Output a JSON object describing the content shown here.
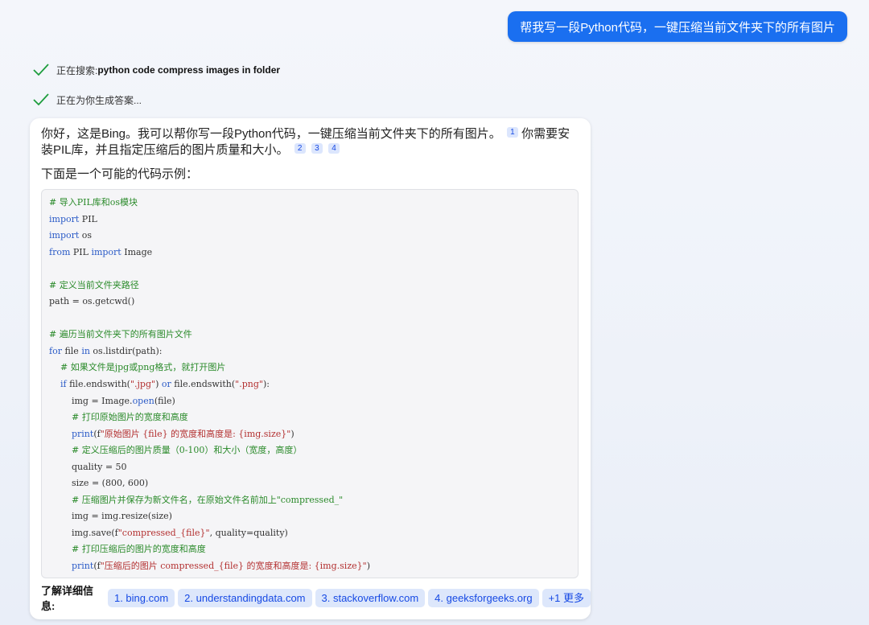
{
  "user_message": "帮我写一段Python代码，一键压缩当前文件夹下的所有图片",
  "status": {
    "searching_prefix": "正在搜索: ",
    "searching_query": "python code compress images in folder",
    "generating": "正在为你生成答案..."
  },
  "answer": {
    "p1a": "你好，这是Bing。我可以帮你写一段Python代码，一键压缩当前文件夹下的所有图片。",
    "cite1": "1",
    "p1b": "你需要安装PIL库，并且指定压缩后的图片质量和大小。",
    "cite2": "2",
    "cite3": "3",
    "cite4": "4",
    "intro": "下面是一个可能的代码示例："
  },
  "code_lines": [
    [
      {
        "t": "# 导入PIL库和os模块",
        "c": "c"
      }
    ],
    [
      {
        "t": "import",
        "c": "k"
      },
      {
        "t": " PIL",
        "c": ""
      }
    ],
    [
      {
        "t": "import",
        "c": "k"
      },
      {
        "t": " os",
        "c": ""
      }
    ],
    [
      {
        "t": "from",
        "c": "k"
      },
      {
        "t": " PIL ",
        "c": ""
      },
      {
        "t": "import",
        "c": "k"
      },
      {
        "t": " Image",
        "c": ""
      }
    ],
    [],
    [
      {
        "t": "# 定义当前文件夹路径",
        "c": "c"
      }
    ],
    [
      {
        "t": "path = os.getcwd()",
        "c": ""
      }
    ],
    [],
    [
      {
        "t": "# 遍历当前文件夹下的所有图片文件",
        "c": "c"
      }
    ],
    [
      {
        "t": "for",
        "c": "k"
      },
      {
        "t": " file ",
        "c": ""
      },
      {
        "t": "in",
        "c": "k"
      },
      {
        "t": " os.listdir(path):",
        "c": ""
      }
    ],
    [
      {
        "t": "    ",
        "c": ""
      },
      {
        "t": "# 如果文件是jpg或png格式，就打开图片",
        "c": "c"
      }
    ],
    [
      {
        "t": "    ",
        "c": ""
      },
      {
        "t": "if",
        "c": "k"
      },
      {
        "t": " file.endswith(",
        "c": ""
      },
      {
        "t": "\".jpg\"",
        "c": "s"
      },
      {
        "t": ") ",
        "c": ""
      },
      {
        "t": "or",
        "c": "k"
      },
      {
        "t": " file.endswith(",
        "c": ""
      },
      {
        "t": "\".png\"",
        "c": "s"
      },
      {
        "t": "):",
        "c": ""
      }
    ],
    [
      {
        "t": "        img = Image.",
        "c": ""
      },
      {
        "t": "open",
        "c": "f"
      },
      {
        "t": "(file)",
        "c": ""
      }
    ],
    [
      {
        "t": "        ",
        "c": ""
      },
      {
        "t": "# 打印原始图片的宽度和高度",
        "c": "c"
      }
    ],
    [
      {
        "t": "        ",
        "c": ""
      },
      {
        "t": "print",
        "c": "f"
      },
      {
        "t": "(f",
        "c": ""
      },
      {
        "t": "\"原始图片 {file} 的宽度和高度是: {img.size}\"",
        "c": "s"
      },
      {
        "t": ")",
        "c": ""
      }
    ],
    [
      {
        "t": "        ",
        "c": ""
      },
      {
        "t": "# 定义压缩后的图片质量（0-100）和大小（宽度，高度）",
        "c": "c"
      }
    ],
    [
      {
        "t": "        quality = 50",
        "c": ""
      }
    ],
    [
      {
        "t": "        size = (800, 600)",
        "c": ""
      }
    ],
    [
      {
        "t": "        ",
        "c": ""
      },
      {
        "t": "# 压缩图片并保存为新文件名，在原始文件名前加上\"compressed_\"",
        "c": "c"
      }
    ],
    [
      {
        "t": "        img = img.resize(size)",
        "c": ""
      }
    ],
    [
      {
        "t": "        img.save(f",
        "c": ""
      },
      {
        "t": "\"compressed_{file}\"",
        "c": "s"
      },
      {
        "t": ", quality=quality)",
        "c": ""
      }
    ],
    [
      {
        "t": "        ",
        "c": ""
      },
      {
        "t": "# 打印压缩后的图片的宽度和高度",
        "c": "c"
      }
    ],
    [
      {
        "t": "        ",
        "c": ""
      },
      {
        "t": "print",
        "c": "f"
      },
      {
        "t": "(f",
        "c": ""
      },
      {
        "t": "\"压缩后的图片 compressed_{file} 的宽度和高度是: {img.size}\"",
        "c": "s"
      },
      {
        "t": ")",
        "c": ""
      }
    ]
  ],
  "learn_more": {
    "label": "了解详细信息:",
    "sources": [
      "1. bing.com",
      "2. understandingdata.com",
      "3. stackoverflow.com",
      "4. geeksforgeeks.org"
    ],
    "more": "+1 更多"
  },
  "colors": {
    "accent": "#1a6ff0",
    "check": "#1e9d3d",
    "comment": "#2a8a2a",
    "keyword": "#2b5bc7",
    "string": "#b33030"
  }
}
